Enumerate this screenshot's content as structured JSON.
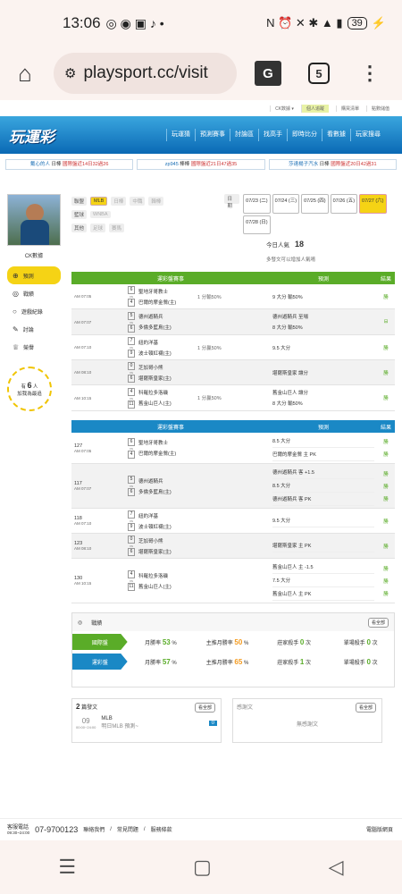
{
  "status": {
    "time": "13:06",
    "battery": "39"
  },
  "browser": {
    "url": "playsport.cc/visit",
    "tab_count": "5"
  },
  "topline": [
    "CK数據 ▾",
    "個人追蹤",
    "購買清單",
    "點數儲值"
  ],
  "site": {
    "logo": "玩運彩",
    "nav": [
      "玩運猜",
      "預測賽事",
      "討論區",
      "找高手",
      "即時比分",
      "看數據",
      "玩家搜尋"
    ]
  },
  "ticker": [
    {
      "user": "戴心的人",
      "rank": "日棒",
      "txt": "國際盤近14日32過26"
    },
    {
      "user": "zp945",
      "rank": "棒棒",
      "txt": "國際盤近21日47過35"
    },
    {
      "user": "莎達楊子汽水",
      "rank": "日棒",
      "txt": "國際盤近20日42過31"
    }
  ],
  "profile": {
    "name": "CK數據",
    "menu": [
      "預測",
      "戰績",
      "遊戲紀錄",
      "討論",
      "榮譽"
    ],
    "fans_prefix": "有",
    "fans": "6",
    "fans_unit": "人",
    "fans_sub": "加我為最追"
  },
  "filters": {
    "row1": [
      "聯盟",
      "MLB",
      "日棒",
      "中職",
      "韓棒"
    ],
    "row2": [
      "籃球",
      "WNBA"
    ],
    "row3": [
      "其他",
      "足球",
      "賽馬"
    ]
  },
  "dates": {
    "label": "日期",
    "items": [
      "07/23 (二)",
      "07/24 (三)",
      "07/25 (四)",
      "07/26 (五)",
      "07/27 (六)",
      "07/28 (日)"
    ]
  },
  "popularity": {
    "label": "今日人氣",
    "value": "18",
    "note": "多發文可以增加人氣唷"
  },
  "intl": {
    "h1": "運彩盤賽事",
    "h2": "預測",
    "h3": "結果",
    "rows": [
      {
        "time": "AM 07:05",
        "s1": "6",
        "s2": "4",
        "t1": "聖地牙哥教士",
        "t2": "巴爾的摩金鶯(主)",
        "odds": "1 分輸50%",
        "p1": "9 大分 輸50%",
        "p2": "",
        "r": "勝"
      },
      {
        "time": "AM 07:07",
        "s1": "5",
        "s2": "6",
        "t1": "德州遊騎兵",
        "t2": "多倫多藍鳥(主)",
        "odds": "",
        "p1": "德州遊騎兵 至場",
        "p2": "8 大分 輸50%",
        "r": "⊟"
      },
      {
        "time": "AM 07:10",
        "s1": "7",
        "s2": "9",
        "t1": "紐約洋基",
        "t2": "波士頓紅襪(主)",
        "odds": "1 分贏50%",
        "p1": "9.5 大分",
        "p2": "",
        "r": "勝"
      },
      {
        "time": "AM 08:10",
        "s1": "0",
        "s2": "6",
        "t1": "芝加哥小熊",
        "t2": "堪薩斯皇家(主)",
        "odds": "",
        "p1": "堪薩斯皇家 讓分",
        "p2": "",
        "r": "勝"
      },
      {
        "time": "AM 10:15",
        "s1": "4",
        "s2": "11",
        "t1": "科羅拉多洛磯",
        "t2": "舊金山巨人(主)",
        "odds": "1 分贏50%",
        "p1": "舊金山巨人 讓分",
        "p2": "8 大分 輸50%",
        "r": "勝"
      }
    ]
  },
  "tw": {
    "h1": "運彩盤賽事",
    "h2": "預測",
    "h3": "結果",
    "rows": [
      {
        "no": "127",
        "time": "AM 07:05",
        "s1": "6",
        "s2": "4",
        "t1": "聖地牙哥教士",
        "t2": "巴爾的摩金鶯(主)",
        "p": [
          "8.5 大分",
          "巴爾的摩金鶯 主 PK"
        ],
        "r": [
          "勝",
          "勝"
        ]
      },
      {
        "no": "117",
        "time": "AM 07:07",
        "s1": "5",
        "s2": "6",
        "t1": "德州遊騎兵",
        "t2": "多倫多藍鳥(主)",
        "p": [
          "德州遊騎兵 客 +1.5",
          "8.5 大分",
          "德州遊騎兵 客 PK"
        ],
        "r": [
          "勝",
          "勝",
          "勝"
        ]
      },
      {
        "no": "118",
        "time": "AM 07:10",
        "s1": "7",
        "s2": "9",
        "t1": "紐約洋基",
        "t2": "波士頓紅襪(主)",
        "p": [
          "9.5 大分"
        ],
        "r": [
          "勝"
        ]
      },
      {
        "no": "123",
        "time": "AM 08:10",
        "s1": "0",
        "s2": "6",
        "t1": "芝加哥小熊",
        "t2": "堪薩斯皇家(主)",
        "p": [
          "堪薩斯皇家 主 PK"
        ],
        "r": [
          "勝"
        ]
      },
      {
        "no": "130",
        "time": "AM 10:15",
        "s1": "4",
        "s2": "11",
        "t1": "科羅拉多洛磯",
        "t2": "舊金山巨人(主)",
        "p": [
          "舊金山巨人 主 -1.5",
          "7.5 大分",
          "舊金山巨人 主 PK"
        ],
        "r": [
          "勝",
          "勝",
          "勝"
        ]
      }
    ]
  },
  "record": {
    "title": "戰績",
    "more": "看全部",
    "rows": [
      {
        "label": "國際盤",
        "color": "#5aac28",
        "m": "月勝率",
        "mv": "53",
        "mu": "%",
        "h": "主推月勝率",
        "hv": "50",
        "hu": "%",
        "k": "莊家殺手",
        "kv": "0",
        "ku": "次",
        "s": "單場殺手",
        "sv": "0",
        "su": "次"
      },
      {
        "label": "運彩盤",
        "color": "#1a88c5",
        "m": "月勝率",
        "mv": "57",
        "mu": "%",
        "h": "主推月勝率",
        "hv": "65",
        "hu": "%",
        "k": "莊家殺手",
        "kv": "1",
        "ku": "次",
        "s": "單場殺手",
        "sv": "0",
        "su": "次"
      }
    ]
  },
  "posts": {
    "count": "2",
    "label": "篇發文",
    "more": "看全部",
    "day": "09",
    "date_range": "00:00~24:00",
    "title": "MLB",
    "sub": "明日MLB 預測~",
    "reply": "0"
  },
  "thanks": {
    "title": "感謝文",
    "more": "看全部",
    "empty": "無感謝文"
  },
  "footer": {
    "label": "客服電話",
    "hours": "09:30~24:00",
    "phone": "07-9700123",
    "links": [
      "聯絡我們",
      "常見問題",
      "服務條款"
    ],
    "side": "電腦版網頁"
  }
}
